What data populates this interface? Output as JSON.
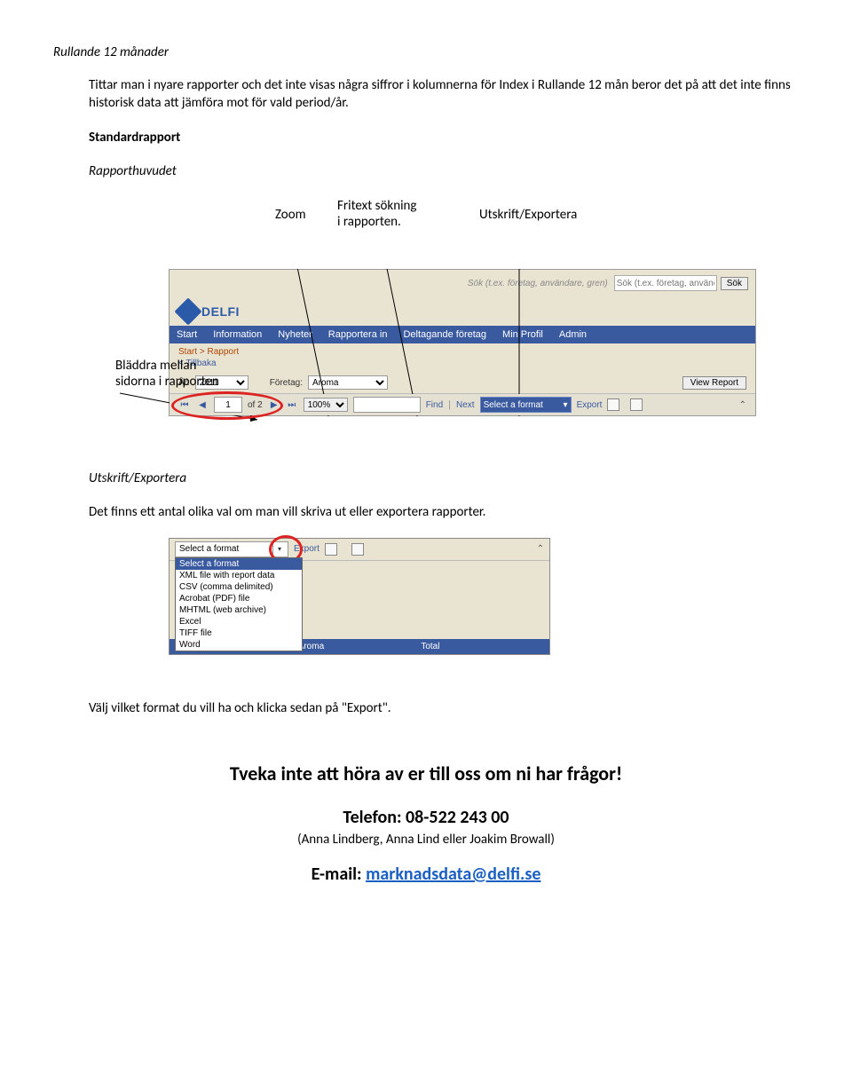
{
  "doc": {
    "heading1": "Rullande 12 månader",
    "p1": "Tittar man i nyare rapporter och det inte visas några siffror i kolumnerna för Index i Rullande 12 mån beror det på att det inte finns historisk data att jämföra mot för vald period/år.",
    "heading2": "Standardrapport",
    "heading3": "Rapporthuvudet",
    "ann_zoom": "Zoom",
    "ann_fritext_l1": "Fritext sökning",
    "ann_fritext_l2": "i rapporten.",
    "ann_utskrift": "Utskrift/Exportera",
    "ann_bladdra_l1": "Bläddra mellan",
    "ann_bladdra_l2": "sidorna i rapporten",
    "heading4": "Utskrift/Exportera",
    "p2": "Det finns ett antal olika val om man vill skriva ut eller exportera rapporter.",
    "p3": "Välj vilket format du vill ha och klicka sedan på \"Export\".",
    "closing_big": "Tveka inte att höra av er till oss om ni har frågor!",
    "closing_tel": "Telefon: 08-522 243 00",
    "closing_names": "(Anna Lindberg, Anna Lind eller Joakim Browall)",
    "closing_email_label": "E-mail: ",
    "closing_email": "marknadsdata@delfi.se"
  },
  "shot1": {
    "search_hint": "Sök (t.ex. företag, användare, gren)",
    "search_btn": "Sök",
    "logo": "DELFI",
    "nav": [
      "Start",
      "Information",
      "Nyheter",
      "Rapportera in",
      "Deltagande företag",
      "Min Profil",
      "Admin"
    ],
    "crumb": "Start > Rapport",
    "back": "< Tillbaka",
    "year_label": "År:",
    "year_value": "2011",
    "company_label": "Företag:",
    "company_value": "Aroma",
    "view_btn": "View Report",
    "page_value": "1",
    "of_text": "of 2",
    "zoom_value": "100%",
    "find": "Find",
    "next": "Next",
    "format_value": "Select a format",
    "export": "Export"
  },
  "shot2": {
    "format_value": "Select a format",
    "export": "Export",
    "options": [
      "Select a format",
      "XML file with report data",
      "CSV (comma delimited)",
      "Acrobat (PDF) file",
      "MHTML (web archive)",
      "Excel",
      "TIFF file",
      "Word"
    ],
    "bottom_left": "",
    "bottom_mid": "Aroma",
    "bottom_right": "Total"
  }
}
